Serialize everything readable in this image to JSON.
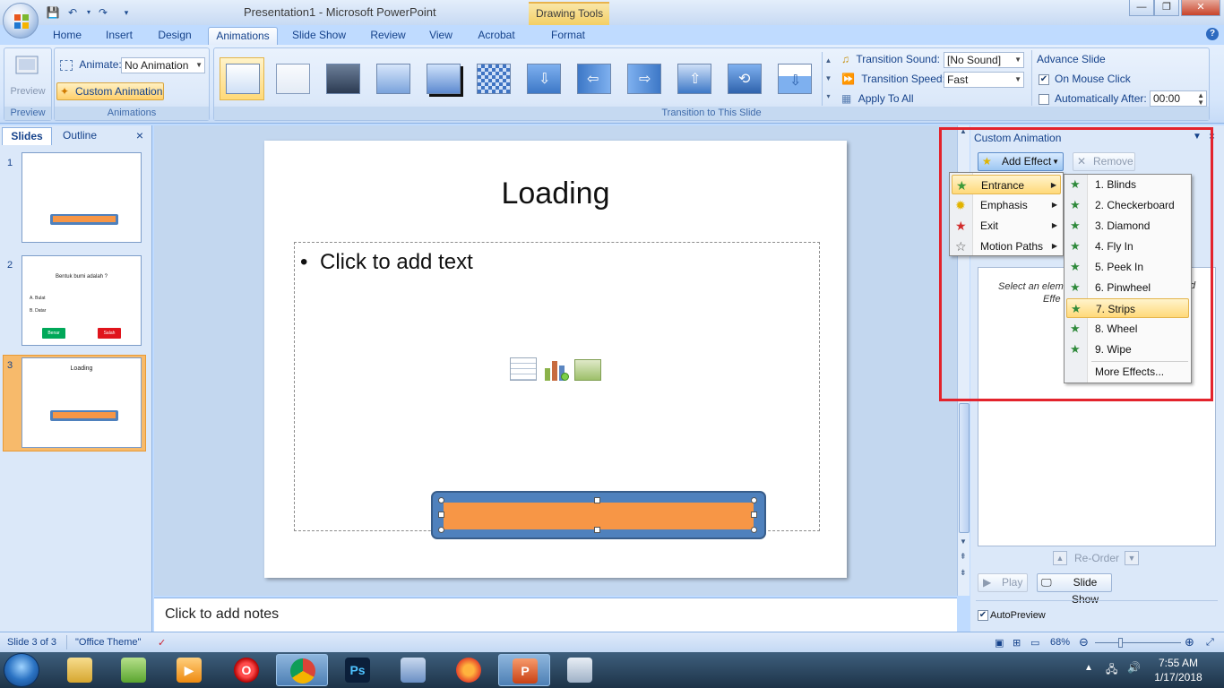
{
  "window": {
    "title": "Presentation1 - Microsoft PowerPoint",
    "context_tab_title": "Drawing Tools"
  },
  "ribbon_tabs": [
    "Home",
    "Insert",
    "Design",
    "Animations",
    "Slide Show",
    "Review",
    "View",
    "Acrobat",
    "Format"
  ],
  "active_tab": "Animations",
  "ribbon": {
    "preview_label": "Preview",
    "preview_group": "Preview",
    "animate_label": "Animate:",
    "animate_value": "No Animation",
    "custom_animation_label": "Custom Animation",
    "animations_group": "Animations",
    "transition_group": "Transition to This Slide",
    "transition_sound_label": "Transition Sound:",
    "transition_sound_value": "[No Sound]",
    "transition_speed_label": "Transition Speed:",
    "transition_speed_value": "Fast",
    "apply_to_all_label": "Apply To All",
    "advance_slide_label": "Advance Slide",
    "on_mouse_click_label": "On Mouse Click",
    "on_mouse_click_checked": true,
    "auto_after_label": "Automatically After:",
    "auto_after_checked": false,
    "auto_after_value": "00:00"
  },
  "left_pane": {
    "tabs": [
      "Slides",
      "Outline"
    ],
    "close_label": "×",
    "slides": [
      {
        "number": "1",
        "title": ""
      },
      {
        "number": "2",
        "title": "Bentuk bumi adalah ?",
        "option_a": "A. Bulat",
        "option_b": "B. Datar",
        "button_correct": "Benar",
        "button_wrong": "Salah"
      },
      {
        "number": "3",
        "title": "Loading"
      }
    ],
    "selected_slide": 3
  },
  "slide": {
    "title": "Loading",
    "placeholder": "Click to add text"
  },
  "notes": {
    "placeholder": "Click to add notes"
  },
  "task_pane": {
    "title": "Custom Animation",
    "add_effect_label": "Add Effect",
    "remove_label": "Remove",
    "hint_text": "Select an element of the slide, then click \"Add Effect\" to add animation.",
    "hint_visible_line1": "Select an eleme",
    "hint_visible_line2": "Effe",
    "hint_visible_right": "d",
    "reorder_label": "Re-Order",
    "play_label": "Play",
    "slide_show_label": "Slide Show",
    "autopreview_label": "AutoPreview",
    "autopreview_checked": true
  },
  "add_effect_menu": {
    "items": [
      {
        "label": "Entrance",
        "icon": "entrance-star-icon"
      },
      {
        "label": "Emphasis",
        "icon": "emphasis-star-icon"
      },
      {
        "label": "Exit",
        "icon": "exit-star-icon"
      },
      {
        "label": "Motion Paths",
        "icon": "motion-path-star-icon"
      }
    ],
    "highlighted": "Entrance"
  },
  "entrance_submenu": {
    "items": [
      "1. Blinds",
      "2. Checkerboard",
      "3. Diamond",
      "4. Fly In",
      "5. Peek In",
      "6. Pinwheel",
      "7. Strips",
      "8. Wheel",
      "9. Wipe"
    ],
    "highlighted": "7. Strips",
    "more_effects_label": "More Effects..."
  },
  "status_bar": {
    "slide_info": "Slide 3 of 3",
    "theme": "\"Office Theme\"",
    "zoom": "68%"
  },
  "taskbar": {
    "time": "7:55 AM",
    "date": "1/17/2018",
    "apps": [
      "file-explorer",
      "notepad",
      "media-player",
      "opera",
      "chrome",
      "photoshop",
      "virtualbox",
      "firefox",
      "powerpoint",
      "paint"
    ]
  },
  "colors": {
    "accent_frame": "#e3232c",
    "shape_fill": "#f79646",
    "shape_border": "#4f81bd",
    "menu_highlight": "#ffd97a"
  }
}
